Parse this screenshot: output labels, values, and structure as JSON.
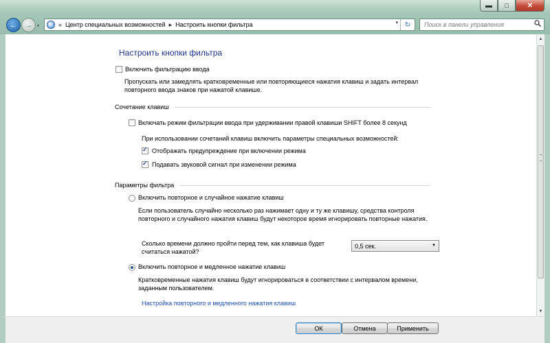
{
  "window": {
    "min_glyph": "▬",
    "max_glyph": "□",
    "close_glyph": "✕"
  },
  "address": {
    "recent_glyph": "▾",
    "sep1": "«",
    "crumb1": "Центр специальных возможностей",
    "sep2": "▸",
    "crumb2": "Настроить кнопки фильтра",
    "dropdown_glyph": "▾",
    "refresh_glyph": "↻"
  },
  "search": {
    "placeholder": "Поиск в панели управления"
  },
  "page": {
    "title": "Настроить кнопки фильтра",
    "enable_filter_label": "Включить фильтрацию ввода",
    "enable_filter_checked": false,
    "enable_filter_desc": "Пропускать или замедлять кратковременные или повторяющиеся нажатия клавиш и задать интервал повторного ввода знаков при нажатой клавише."
  },
  "shortcut_section": {
    "heading": "Сочетание клавиш",
    "shift_label": "Включать режим фильтрации ввода при удерживании правой клавиши SHIFT более 8 секунд",
    "shift_checked": false,
    "when_using_text": "При использовании сочетаний клавиш включить параметры специальных возможностей:",
    "warning_label": "Отображать предупреждение при включении режима",
    "warning_checked": true,
    "sound_label": "Подавать звуковой сигнал при изменении режима",
    "sound_checked": true
  },
  "filter_section": {
    "heading": "Параметры фильтра",
    "bounce_label": "Включить повторное и случайное нажатие клавиш",
    "bounce_selected": false,
    "bounce_desc": "Если пользователь случайно несколько раз нажимает одну и ту же клавишу, средства контроля повторного и случайного нажатия клавиш будут некоторое время игнорировать повторные нажатия.",
    "bounce_time_question": "Сколько времени должно пройти перед тем, как клавиша будет считаться нажатой?",
    "bounce_time_value": "0,5 сек.",
    "repeat_label": "Включить повторное и медленное нажатие клавиш",
    "repeat_selected": true,
    "repeat_desc": "Кратковременные нажатия клавиш будут игнорироваться в соответствии с интервалом времени, заданным пользователем.",
    "repeat_link": "Настройка повторного и медленного нажатия клавиш"
  },
  "footer": {
    "ok": "ОК",
    "cancel": "Отмена",
    "apply": "Применить"
  },
  "colors": {
    "frame": "#b1cdbf",
    "title_blue": "#1e3287",
    "link_blue": "#1c4fa8"
  }
}
